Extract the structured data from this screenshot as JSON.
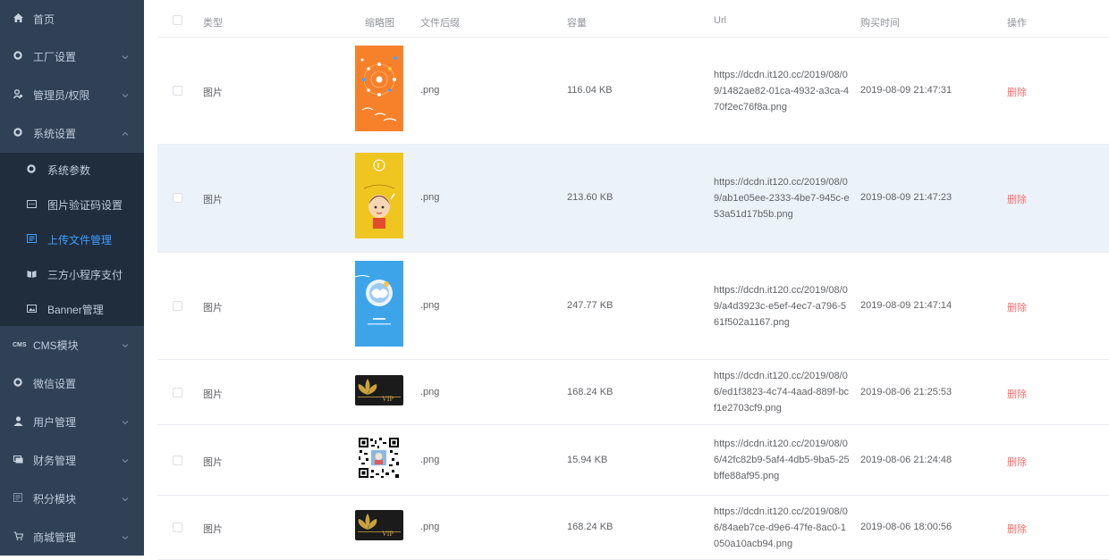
{
  "sidebar": {
    "items": [
      {
        "label": "首页",
        "icon": "home-icon"
      },
      {
        "label": "工厂设置",
        "icon": "gear-icon"
      },
      {
        "label": "管理员/权限",
        "icon": "admin-icon"
      },
      {
        "label": "系统设置",
        "icon": "gear-icon"
      }
    ],
    "sub_items": [
      {
        "label": "系统参数",
        "icon": "gear-icon"
      },
      {
        "label": "图片验证码设置",
        "icon": "captcha-icon"
      },
      {
        "label": "上传文件管理",
        "icon": "file-icon"
      },
      {
        "label": "三方小程序支付",
        "icon": "miniprogram-icon"
      },
      {
        "label": "Banner管理",
        "icon": "banner-icon"
      }
    ],
    "bottom_items": [
      {
        "label": "CMS模块",
        "icon": "cms-icon",
        "icon_text": "CMS"
      },
      {
        "label": "微信设置",
        "icon": "gear-icon"
      },
      {
        "label": "用户管理",
        "icon": "user-icon"
      },
      {
        "label": "财务管理",
        "icon": "finance-icon"
      },
      {
        "label": "积分模块",
        "icon": "points-icon"
      },
      {
        "label": "商城管理",
        "icon": "cart-icon"
      }
    ],
    "active_color": "#409eff"
  },
  "table": {
    "headers": {
      "type": "类型",
      "thumb": "缩略图",
      "ext": "文件后缀",
      "size": "容量",
      "url": "Url",
      "time": "购买时间",
      "action": "操作"
    },
    "rows": [
      {
        "type": "图片",
        "ext": ".png",
        "size": "116.04 KB",
        "url": "https://dcdn.it120.cc/2019/08/09/1482ae82-01ca-4932-a3ca-470f2ec76f8a.png",
        "time": "2019-08-09 21:47:31",
        "action": "删除",
        "thumb": "orange-poster"
      },
      {
        "type": "图片",
        "ext": ".png",
        "size": "213.60 KB",
        "url": "https://dcdn.it120.cc/2019/08/09/ab1e05ee-2333-4be7-945c-e53a51d17b5b.png",
        "time": "2019-08-09 21:47:23",
        "action": "删除",
        "thumb": "yellow-cartoon-poster"
      },
      {
        "type": "图片",
        "ext": ".png",
        "size": "247.77 KB",
        "url": "https://dcdn.it120.cc/2019/08/09/a4d3923c-e5ef-4ec7-a796-561f502a1167.png",
        "time": "2019-08-09 21:47:14",
        "action": "删除",
        "thumb": "blue-poster"
      },
      {
        "type": "图片",
        "ext": ".png",
        "size": "168.24 KB",
        "url": "https://dcdn.it120.cc/2019/08/06/ed1f3823-4c74-4aad-889f-bcf1e2703cf9.png",
        "time": "2019-08-06 21:25:53",
        "action": "删除",
        "thumb": "vip-card",
        "thumb_text": "VIP"
      },
      {
        "type": "图片",
        "ext": ".png",
        "size": "15.94 KB",
        "url": "https://dcdn.it120.cc/2019/08/06/42fc82b9-5af4-4db5-9ba5-25bffe88af95.png",
        "time": "2019-08-06 21:24:48",
        "action": "删除",
        "thumb": "qr-code"
      },
      {
        "type": "图片",
        "ext": ".png",
        "size": "168.24 KB",
        "url": "https://dcdn.it120.cc/2019/08/06/84aeb7ce-d9e6-47fe-8ac0-1050a10acb94.png",
        "time": "2019-08-06 18:00:56",
        "action": "删除",
        "thumb": "vip-card",
        "thumb_text": "VIP"
      }
    ]
  },
  "colors": {
    "sidebar_bg": "#304156",
    "submenu_bg": "#1f2d3d",
    "delete": "#f56c6c",
    "row_highlight": "#ecf2fa"
  }
}
